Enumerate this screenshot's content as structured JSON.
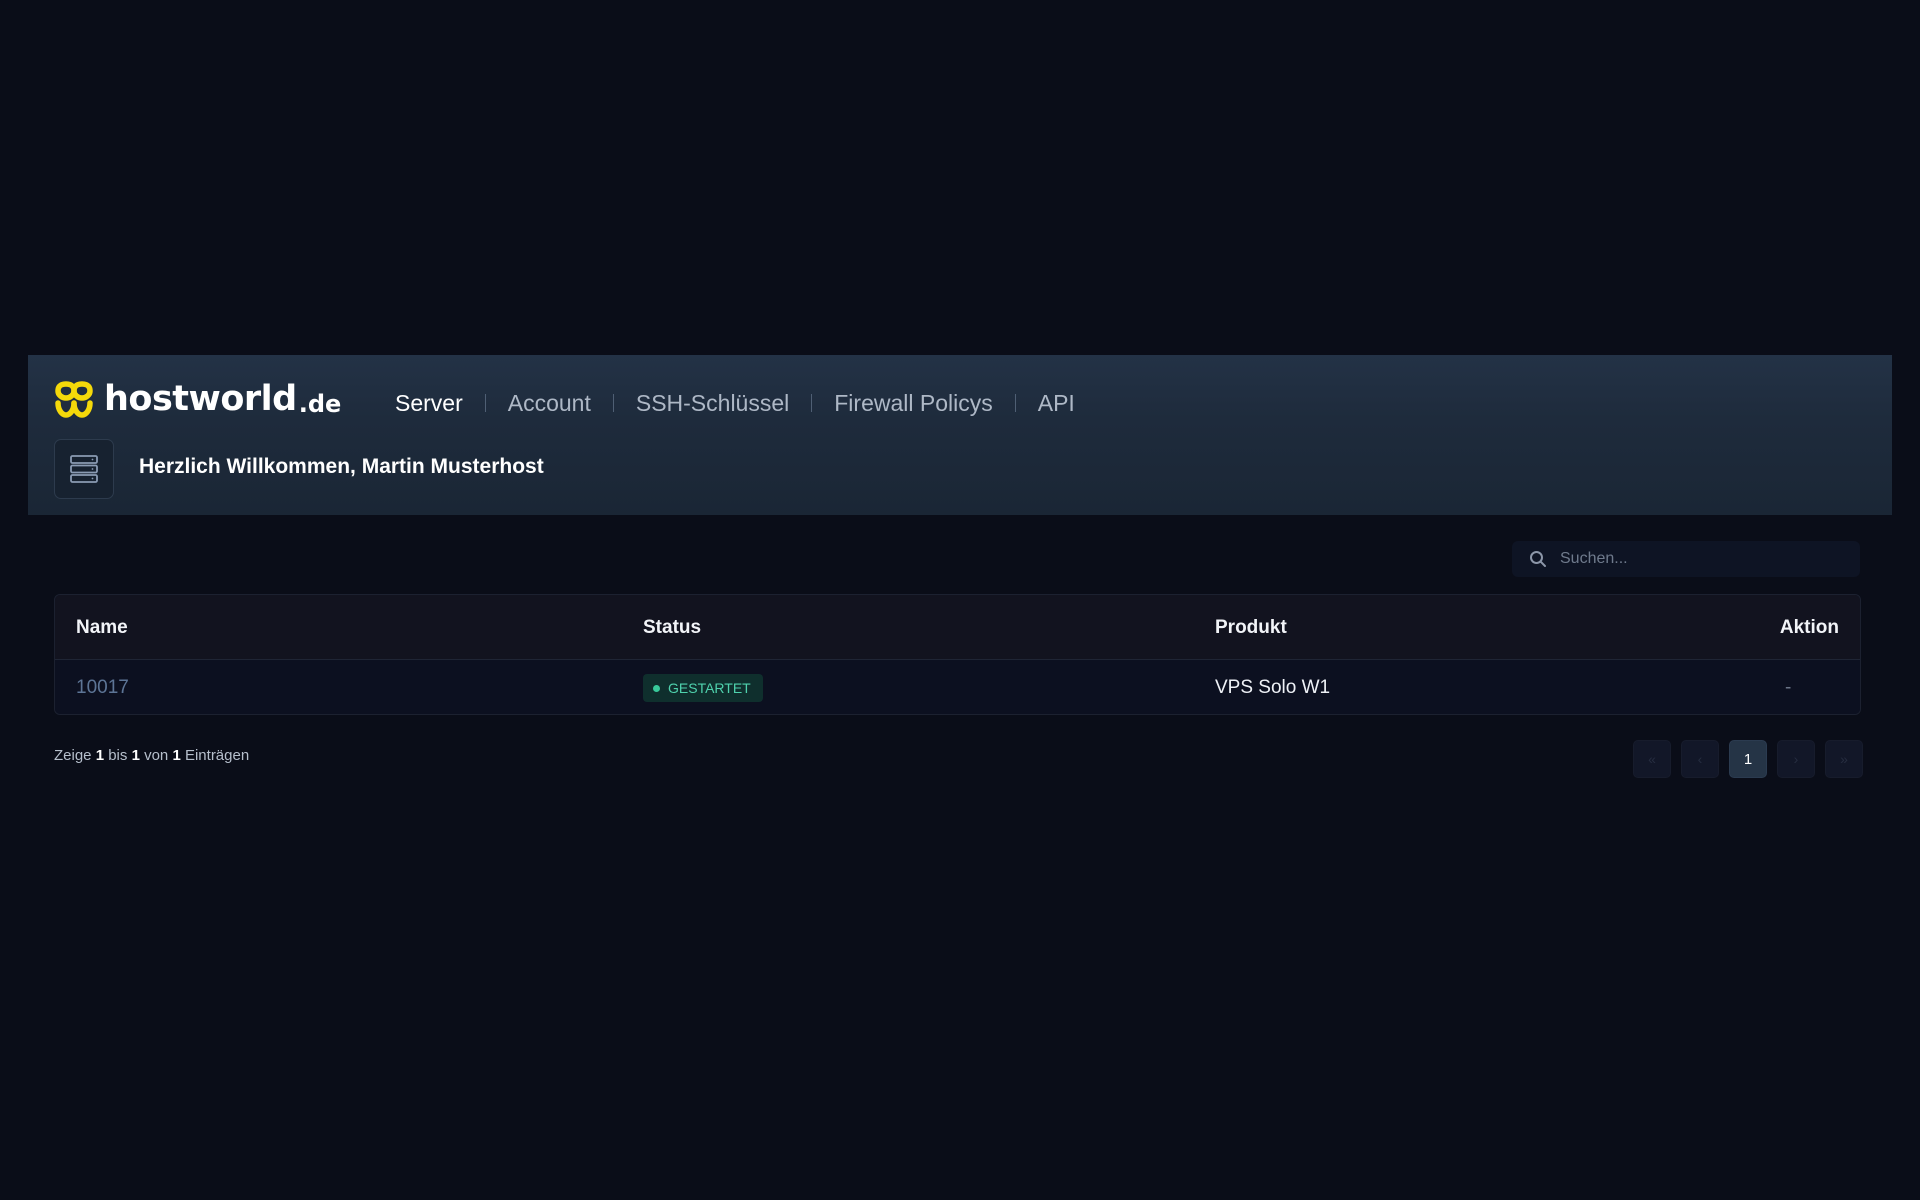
{
  "brand": {
    "name": "hostworld",
    "tld": ".de",
    "logo_icon": "hostworld-logo-icon",
    "accent_color": "#f5d90a"
  },
  "nav": {
    "items": [
      {
        "label": "Server",
        "active": true
      },
      {
        "label": "Account",
        "active": false
      },
      {
        "label": "SSH-Schlüssel",
        "active": false
      },
      {
        "label": "Firewall Policys",
        "active": false
      },
      {
        "label": "API",
        "active": false
      }
    ]
  },
  "welcome": {
    "icon": "server-stack-icon",
    "text": "Herzlich Willkommen, Martin Musterhost"
  },
  "search": {
    "placeholder": "Suchen...",
    "value": "",
    "icon": "search-icon"
  },
  "table": {
    "columns": [
      "Name",
      "Status",
      "Produkt",
      "Aktion"
    ],
    "rows": [
      {
        "name": "10017",
        "status": "GESTARTET",
        "status_color": "#38c99a",
        "product": "VPS Solo W1",
        "action": "-"
      }
    ]
  },
  "footer": {
    "info_prefix": "Zeige",
    "from": "1",
    "mid1": "bis",
    "to": "1",
    "mid2": "von",
    "total": "1",
    "suffix": "Einträgen"
  },
  "pagination": {
    "first": "«",
    "prev": "‹",
    "current": "1",
    "next": "›",
    "last": "»"
  }
}
